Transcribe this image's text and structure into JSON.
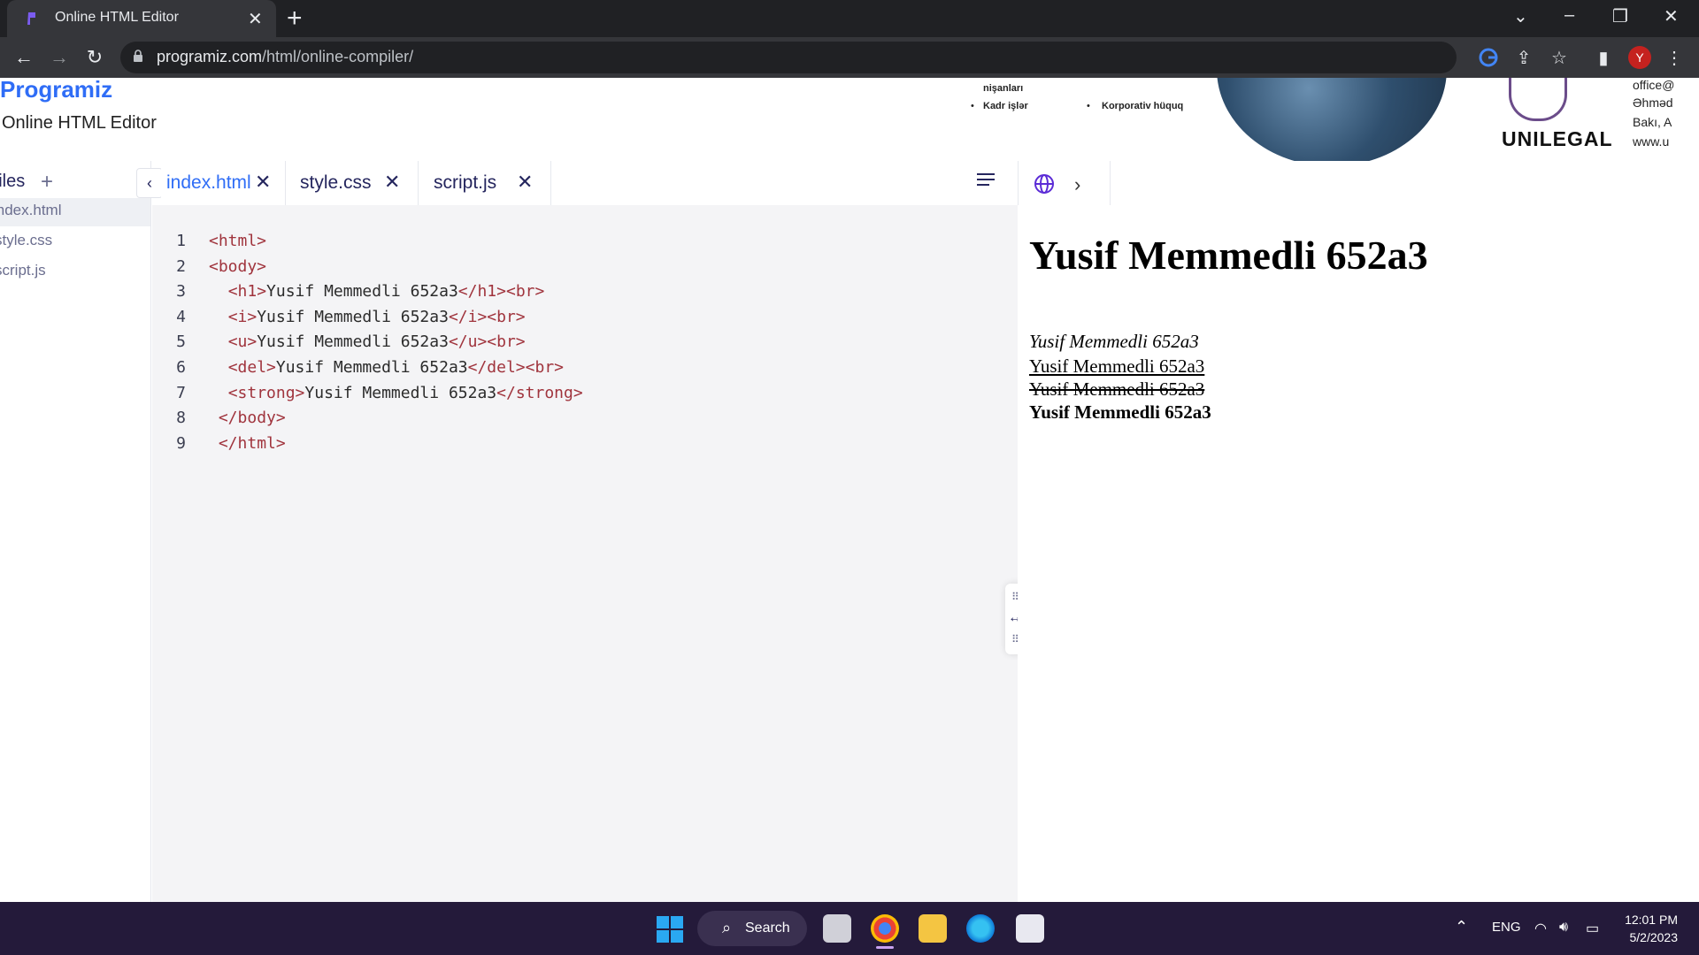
{
  "browser": {
    "tab_title": "Online HTML Editor",
    "url_host": "programiz.com",
    "url_path": "/html/online-compiler/",
    "profile_initial": "Y"
  },
  "header": {
    "brand": "Programiz",
    "page_title": "Online HTML Editor"
  },
  "ad": {
    "line1": "nişanları",
    "line2": "Kadr işlər",
    "line3": "Korporativ hüquq",
    "logo": "UNILEGAL",
    "contact1": "office@",
    "contact2": "Əhməd",
    "contact3": "Bakı, A",
    "contact4": "www.u"
  },
  "files": {
    "heading": "Files",
    "items": [
      {
        "label": "index.html"
      },
      {
        "label": "style.css"
      },
      {
        "label": "script.js"
      }
    ]
  },
  "editor": {
    "tabs": [
      {
        "label": "index.html",
        "active": true
      },
      {
        "label": "style.css",
        "active": false
      },
      {
        "label": "script.js",
        "active": false
      }
    ],
    "lines": [
      {
        "num": "1",
        "indent": "",
        "parts": [
          [
            "tag",
            "<html>"
          ]
        ]
      },
      {
        "num": "2",
        "indent": "",
        "parts": [
          [
            "tag",
            "<body>"
          ]
        ]
      },
      {
        "num": "3",
        "indent": "  ",
        "parts": [
          [
            "tag",
            "<h1>"
          ],
          [
            "txt",
            "Yusif Memmedli 652a3"
          ],
          [
            "tag",
            "</h1><br>"
          ]
        ]
      },
      {
        "num": "4",
        "indent": "  ",
        "parts": [
          [
            "tag",
            "<i>"
          ],
          [
            "txt",
            "Yusif Memmedli 652a3"
          ],
          [
            "tag",
            "</i><br>"
          ]
        ]
      },
      {
        "num": "5",
        "indent": "  ",
        "parts": [
          [
            "tag",
            "<u>"
          ],
          [
            "txt",
            "Yusif Memmedli 652a3"
          ],
          [
            "tag",
            "</u><br>"
          ]
        ]
      },
      {
        "num": "6",
        "indent": "  ",
        "parts": [
          [
            "tag",
            "<del>"
          ],
          [
            "txt",
            "Yusif Memmedli 652a3"
          ],
          [
            "tag",
            "</del><br>"
          ]
        ]
      },
      {
        "num": "7",
        "indent": "  ",
        "parts": [
          [
            "tag",
            "<strong>"
          ],
          [
            "txt",
            "Yusif Memmedli 652a3"
          ],
          [
            "tag",
            "</strong>"
          ]
        ]
      },
      {
        "num": "8",
        "indent": " ",
        "parts": [
          [
            "tag",
            "</body>"
          ]
        ]
      },
      {
        "num": "9",
        "indent": " ",
        "parts": [
          [
            "tag",
            "</html>"
          ]
        ]
      }
    ]
  },
  "preview": {
    "h1": "Yusif Memmedli 652a3",
    "italic": "Yusif Memmedli 652a3",
    "underline": "Yusif Memmedli 652a3",
    "strike": "Yusif Memmedli 652a3",
    "bold": "Yusif Memmedli 652a3"
  },
  "taskbar": {
    "search_label": "Search",
    "lang": "ENG",
    "time": "12:01 PM",
    "date": "5/2/2023"
  },
  "colors": {
    "brand_blue": "#2f6df6",
    "tag_red": "#a0343d",
    "taskbar_bg": "#241a3a"
  }
}
